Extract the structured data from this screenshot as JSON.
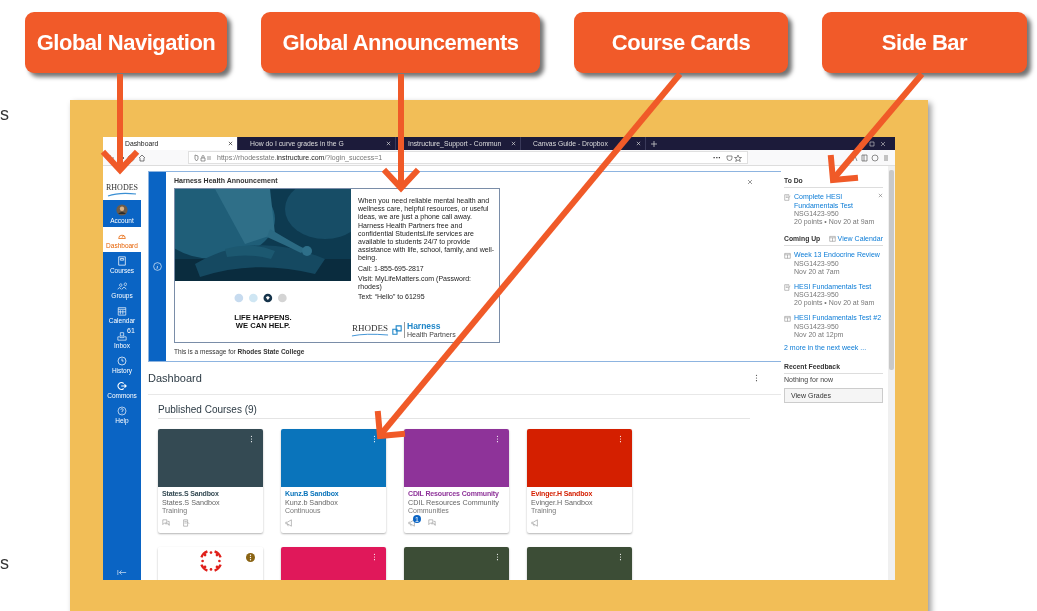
{
  "callouts": [
    {
      "label": "Global Navigation"
    },
    {
      "label": "Global Announcements"
    },
    {
      "label": "Course Cards"
    },
    {
      "label": "Side Bar"
    }
  ],
  "edge_texts": [
    "s",
    "s"
  ],
  "browser": {
    "tabs": [
      {
        "title": "Dashboard",
        "selected": true
      },
      {
        "title": "How do I curve grades in the G",
        "selected": false
      },
      {
        "title": "Instructure_Support - Commun",
        "selected": false
      },
      {
        "title": "Canvas Guide - Dropbox",
        "selected": false
      }
    ],
    "url_host": "https://rhodesstate.",
    "url_domain": "instructure.com",
    "url_path": "/?login_success=1",
    "menu_dots": "···"
  },
  "global_nav": {
    "logo": "RHODES",
    "items": [
      {
        "label": "Account",
        "kind": "avatar",
        "selected": false
      },
      {
        "label": "Dashboard",
        "kind": "dashboard",
        "selected": true
      },
      {
        "label": "Courses",
        "kind": "courses",
        "selected": false
      },
      {
        "label": "Groups",
        "kind": "groups",
        "selected": false
      },
      {
        "label": "Calendar",
        "kind": "calendar",
        "selected": false
      },
      {
        "label": "Inbox",
        "kind": "inbox",
        "selected": false,
        "badge": "61"
      },
      {
        "label": "History",
        "kind": "history",
        "selected": false
      },
      {
        "label": "Commons",
        "kind": "commons",
        "selected": false
      },
      {
        "label": "Help",
        "kind": "help",
        "selected": false
      }
    ]
  },
  "announcement": {
    "title": "Harness Health Announcement",
    "paragraph": "When you need reliable mental health and wellness care, helpful resources, or useful ideas, we are just a phone call away. Harness Health Partners free and confidential StudentsLife services are available to students 24/7 to provide assistance with life, school, family, and well-being.",
    "contacts": [
      "Call: 1-855-695-2817",
      "Visit: MyLifeMatters.com (Password: rhodes)",
      "Text: “Hello” to 61295"
    ],
    "slogan": [
      "LIFE HAPPENS.",
      "WE CAN HELP."
    ],
    "rhodes_logo": "RHODES",
    "harness_logo": "Harness",
    "harness_sub": "Health Partners",
    "footer": "This is a message for **Rhodes State College**"
  },
  "dashboard": {
    "title": "Dashboard",
    "section": "Published Courses (9)",
    "cards": [
      {
        "kind": "color",
        "color": "#344a53",
        "title": "States.S Sandbox",
        "name": "States.S Sandbox",
        "term": "Training",
        "actions": [
          {
            "kind": "discussion"
          },
          {
            "kind": "assignment"
          }
        ]
      },
      {
        "kind": "color",
        "color": "#0a74bb",
        "title": "Kunz.B Sandbox",
        "name": "Kunz.b Sandbox",
        "term": "Continuous",
        "actions": [
          {
            "kind": "announcement"
          }
        ]
      },
      {
        "kind": "color",
        "color": "#8e3399",
        "title": "CDIL Resources Community",
        "name": "CDIL Resources Community",
        "term": "Communities",
        "actions": [
          {
            "kind": "announcement",
            "badge": "1"
          },
          {
            "kind": "discussion"
          }
        ]
      },
      {
        "kind": "color",
        "color": "#d41f00",
        "title": "Evinger.H Sandbox",
        "name": "Evinger.H Sandbox",
        "term": "Training",
        "actions": [
          {
            "kind": "announcement"
          }
        ]
      },
      {
        "kind": "logo",
        "color": "#8a6414"
      },
      {
        "kind": "color",
        "color": "#e0185a"
      },
      {
        "kind": "color",
        "color": "#3c4d36"
      },
      {
        "kind": "color",
        "color": "#3c4d36"
      }
    ]
  },
  "sidebar": {
    "todo": {
      "title": "To Do",
      "items": [
        {
          "kind": "quiz",
          "title": "Complete HESI Fundamentals Test",
          "course": "NSG1423-950",
          "meta": "20 points • Nov 20 at 9am"
        }
      ]
    },
    "coming_up": {
      "title": "Coming Up",
      "link": "View Calendar",
      "items": [
        {
          "kind": "calendar",
          "title": "Week 13 Endocrine Review",
          "course": "NSG1423-950",
          "meta": "Nov 20 at 7am"
        },
        {
          "kind": "quiz",
          "title": "HESI Fundamentals Test",
          "course": "NSG1423-950",
          "meta": "20 points • Nov 20 at 9am"
        },
        {
          "kind": "calendar",
          "title": "HESI Fundamentals Test #2",
          "course": "NSG1423-950",
          "meta": "Nov 20 at 12pm"
        }
      ],
      "more": "2 more in the next week ..."
    },
    "feedback": {
      "title": "Recent Feedback",
      "empty": "Nothing for now"
    },
    "button": "View Grades"
  }
}
